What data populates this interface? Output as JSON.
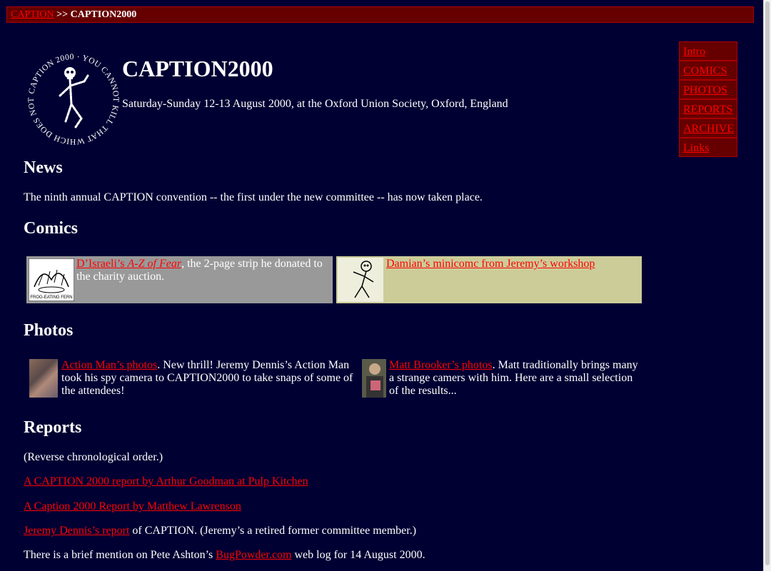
{
  "breadcrumb": {
    "link": "CAPTION",
    "separator": " >> ",
    "current": "CAPTION2000"
  },
  "header": {
    "logo_text": "CAPTION 2000 · YOU CANNOT KILL THAT WHICH DOES NOT LIVE ·",
    "title": "CAPTION2000",
    "subtitle": "Saturday-Sunday 12-13 August 2000, at the Oxford Union Society, Oxford, England"
  },
  "nav": {
    "items": [
      "Intro",
      "COMICS",
      "PHOTOS",
      "REPORTS",
      "ARCHIVE",
      "Links"
    ]
  },
  "news": {
    "heading": "News",
    "text": "The ninth annual CAPTION convention -- the first under the new committee -- has now taken place."
  },
  "comics": {
    "heading": "Comics",
    "items": [
      {
        "link_prefix": "D’Israeli’s ",
        "link_italic": "A-Z of Fear",
        "rest": ", the 2-page strip he donated to the charity auction.",
        "thumb_caption": "FROG-EATING FERN",
        "bg": "#999999"
      },
      {
        "link": "Damian’s minicomc from Jeremy’s workshop",
        "bg": "#cccc99"
      }
    ]
  },
  "photos": {
    "heading": "Photos",
    "items": [
      {
        "link": "Action Man’s photos",
        "rest": ". New thrill! Jeremy Dennis’s Action Man took his spy camera to CAPTION2000 to take snaps of some of the attendees!"
      },
      {
        "link": "Matt Brooker’s photos",
        "rest": ". Matt traditionally brings many a strange camers with him. Here are a small selection of the results..."
      }
    ]
  },
  "reports": {
    "heading": "Reports",
    "note": "(Reverse chronological order.)",
    "link1": "A CAPTION 2000 report by Arthur Goodman at Pulp Kitchen",
    "link2": "A Caption 2000 Report by Matthew Lawrenson",
    "link3": "Jeremy Dennis’s report",
    "link3_rest": " of CAPTION. (Jeremy’s a retired former committee member.)",
    "mention_prefix": "There is a brief mention on Pete Ashton’s ",
    "mention_link": "BugPowder.com",
    "mention_suffix": " web log for 14 August 2000."
  },
  "colors": {
    "background": "#000033",
    "link": "#ff0000",
    "bar": "#660000"
  }
}
